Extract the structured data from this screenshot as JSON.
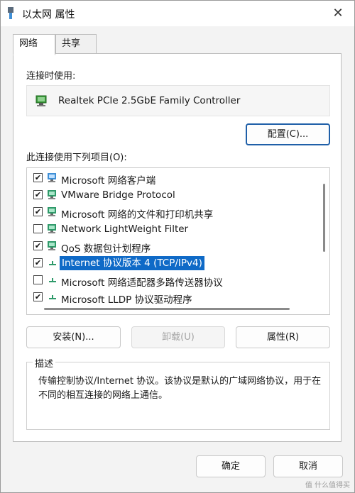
{
  "window": {
    "title": "以太网 属性",
    "close_label": "✕"
  },
  "tabs": [
    {
      "label": "网络",
      "active": true
    },
    {
      "label": "共享",
      "active": false
    }
  ],
  "connect_using": {
    "label": "连接时使用:",
    "adapter_name": "Realtek PCIe 2.5GbE Family Controller",
    "configure_label": "配置(C)..."
  },
  "items": {
    "label": "此连接使用下列项目(O):",
    "list": [
      {
        "label": "Microsoft 网络客户端",
        "checked": true,
        "icon": "network-client-icon"
      },
      {
        "label": "VMware Bridge Protocol",
        "checked": true,
        "icon": "network-service-icon"
      },
      {
        "label": "Microsoft 网络的文件和打印机共享",
        "checked": true,
        "icon": "network-service-icon"
      },
      {
        "label": "Network LightWeight Filter",
        "checked": false,
        "icon": "network-service-icon"
      },
      {
        "label": "QoS 数据包计划程序",
        "checked": true,
        "icon": "network-service-icon"
      },
      {
        "label": "Internet 协议版本 4 (TCP/IPv4)",
        "checked": true,
        "icon": "protocol-icon",
        "selected": true
      },
      {
        "label": "Microsoft 网络适配器多路传送器协议",
        "checked": false,
        "icon": "protocol-icon"
      },
      {
        "label": "Microsoft LLDP 协议驱动程序",
        "checked": true,
        "icon": "protocol-icon"
      }
    ]
  },
  "buttons": {
    "install": "安装(N)...",
    "uninstall": "卸载(U)",
    "properties": "属性(R)",
    "ok": "确定",
    "cancel": "取消"
  },
  "description": {
    "title": "描述",
    "text": "传输控制协议/Internet 协议。该协议是默认的广域网络协议，用于在不同的相互连接的网络上通信。"
  },
  "watermark": "值 什么值得买",
  "colors": {
    "selection": "#0f6ac7",
    "focus_border": "#1f5fa8"
  }
}
